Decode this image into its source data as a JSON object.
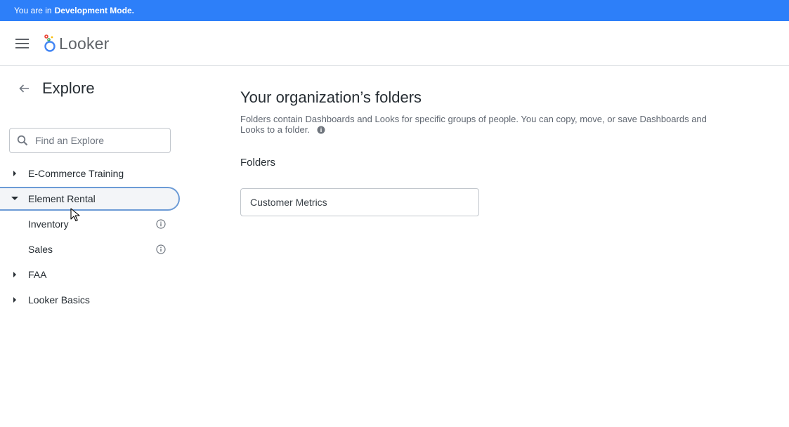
{
  "banner": {
    "prefix": "You are in",
    "mode": "Development Mode."
  },
  "header": {
    "logo_text": "Looker"
  },
  "sidebar": {
    "title": "Explore",
    "search_placeholder": "Find an Explore",
    "items": [
      {
        "label": "E-Commerce Training",
        "expanded": false
      },
      {
        "label": "Element Rental",
        "expanded": true,
        "selected": true,
        "children": [
          {
            "label": "Inventory"
          },
          {
            "label": "Sales"
          }
        ]
      },
      {
        "label": "FAA",
        "expanded": false
      },
      {
        "label": "Looker Basics",
        "expanded": false
      }
    ]
  },
  "main": {
    "title": "Your organization’s folders",
    "description": "Folders contain Dashboards and Looks for specific groups of people. You can copy, move, or save Dashboards and Looks to a folder.",
    "folders_heading": "Folders",
    "folders": [
      {
        "name": "Customer Metrics"
      }
    ]
  },
  "colors": {
    "banner_bg": "#2d7ff9",
    "selected_border": "#6c9bd6",
    "text": "#262d33",
    "muted": "#5f6670"
  }
}
